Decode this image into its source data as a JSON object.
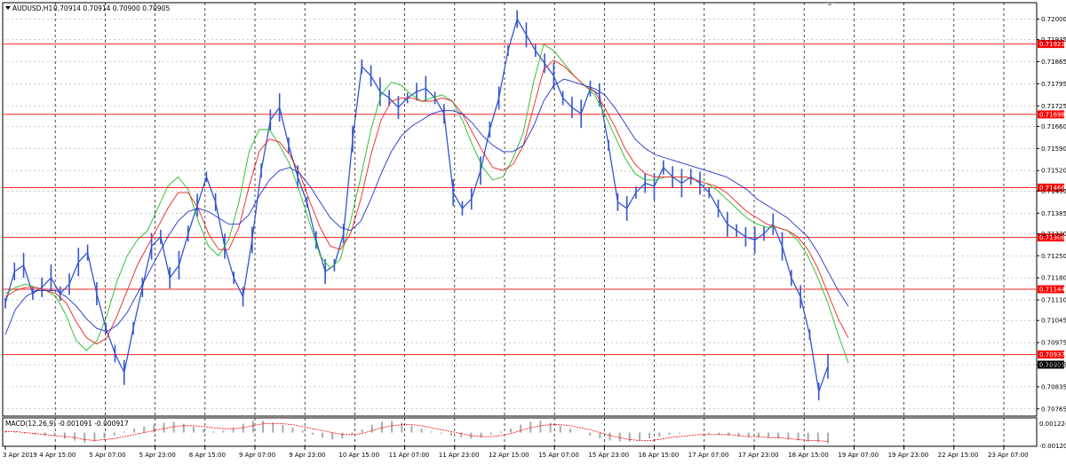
{
  "header": {
    "symbol": "AUDUSD,H1",
    "ohlc": "0.70914 0.70914 0.70900 0.70905"
  },
  "macd": {
    "label": "MACD(12,26,9) -0.001091 -0.000917",
    "axis_top": "0.001224",
    "axis_bottom": "-0.001202"
  },
  "chart_data": {
    "type": "line",
    "title": "AUDUSD,H1",
    "price_scale": {
      "range": [
        0.70742,
        0.72052
      ],
      "ticks": [
        "0.72070",
        "0.72000",
        "0.71935",
        "0.71865",
        "0.71795",
        "0.71725",
        "0.71660",
        "0.71590",
        "0.71520",
        "0.71455",
        "0.71385",
        "0.71320",
        "0.71250",
        "0.71180",
        "0.71110",
        "0.71045",
        "0.70975",
        "0.70905",
        "0.70835",
        "0.70765"
      ]
    },
    "time_labels": [
      "3 Apr 2019",
      "4 Apr 15:00",
      "5 Apr 07:00",
      "5 Apr 23:00",
      "8 Apr 15:00",
      "9 Apr 07:00",
      "9 Apr 23:00",
      "10 Apr 15:00",
      "11 Apr 07:00",
      "11 Apr 23:00",
      "12 Apr 15:00",
      "15 Apr 07:00",
      "15 Apr 23:00",
      "16 Apr 15:00",
      "17 Apr 07:00",
      "17 Apr 23:00",
      "18 Apr 15:00",
      "19 Apr 07:00",
      "19 Apr 23:00",
      "22 Apr 15:00",
      "23 Apr 07:00"
    ],
    "levels": [
      {
        "value": 0.71921,
        "label": "0.71921"
      },
      {
        "value": 0.71698,
        "label": "0.71698"
      },
      {
        "value": 0.71466,
        "label": "0.71466"
      },
      {
        "value": 0.71308,
        "label": "0.71308"
      },
      {
        "value": 0.71144,
        "label": "0.71144"
      },
      {
        "value": 0.70937,
        "label": "0.70937"
      }
    ],
    "current_price": {
      "value": 0.70905,
      "label": "0.70905"
    },
    "series": [
      {
        "key": "price",
        "color": "#3355cc",
        "values": [
          0.711,
          0.712,
          0.7122,
          0.7113,
          0.7115,
          0.7118,
          0.7113,
          0.7116,
          0.7123,
          0.7126,
          0.7113,
          0.7102,
          0.7094,
          0.7088,
          0.7102,
          0.7115,
          0.7128,
          0.7131,
          0.7118,
          0.7122,
          0.7132,
          0.7141,
          0.715,
          0.7142,
          0.7128,
          0.7118,
          0.7112,
          0.713,
          0.7152,
          0.7168,
          0.7172,
          0.716,
          0.715,
          0.7142,
          0.713,
          0.712,
          0.7122,
          0.7132,
          0.7162,
          0.7185,
          0.7182,
          0.7177,
          0.7175,
          0.7172,
          0.7175,
          0.7177,
          0.7178,
          0.7175,
          0.717,
          0.7145,
          0.714,
          0.7143,
          0.7152,
          0.7165,
          0.7175,
          0.719,
          0.72,
          0.7195,
          0.719,
          0.7186,
          0.7182,
          0.7175,
          0.7172,
          0.717,
          0.7178,
          0.7176,
          0.716,
          0.7142,
          0.714,
          0.7145,
          0.7148,
          0.7147,
          0.7153,
          0.715,
          0.7148,
          0.715,
          0.7148,
          0.7145,
          0.714,
          0.7135,
          0.7133,
          0.7131,
          0.713,
          0.7132,
          0.7135,
          0.7128,
          0.7118,
          0.7112,
          0.71,
          0.7082,
          0.709
        ]
      },
      {
        "key": "ma_fast",
        "color": "#22bb22",
        "values": [
          0.7113,
          0.7115,
          0.7116,
          0.7115,
          0.7114,
          0.7112,
          0.7106,
          0.7098,
          0.7095,
          0.7098,
          0.7106,
          0.7117,
          0.7125,
          0.713,
          0.7133,
          0.714,
          0.7147,
          0.715,
          0.7146,
          0.7136,
          0.7128,
          0.7125,
          0.713,
          0.7142,
          0.7158,
          0.7165,
          0.7165,
          0.716,
          0.7154,
          0.7145,
          0.7135,
          0.7125,
          0.7121,
          0.7124,
          0.7136,
          0.715,
          0.7165,
          0.7176,
          0.718,
          0.7179,
          0.7176,
          0.7174,
          0.7175,
          0.7176,
          0.7174,
          0.7168,
          0.716,
          0.7153,
          0.7149,
          0.715,
          0.7156,
          0.7164,
          0.718,
          0.7192,
          0.719,
          0.7186,
          0.7182,
          0.7179,
          0.7176,
          0.717,
          0.7163,
          0.7156,
          0.7151,
          0.7149,
          0.7149,
          0.715,
          0.715,
          0.715,
          0.7149,
          0.7148,
          0.7146,
          0.7143,
          0.714,
          0.7137,
          0.7135,
          0.7134,
          0.7134,
          0.7133,
          0.713,
          0.7125,
          0.7118,
          0.711,
          0.71,
          0.7091
        ]
      },
      {
        "key": "ma_medium",
        "color": "#ee2222",
        "values": [
          0.7112,
          0.7114,
          0.7115,
          0.7115,
          0.7114,
          0.7113,
          0.711,
          0.7104,
          0.7099,
          0.7097,
          0.7099,
          0.7106,
          0.7114,
          0.7122,
          0.7128,
          0.7134,
          0.714,
          0.7145,
          0.7145,
          0.714,
          0.7132,
          0.7127,
          0.7127,
          0.7134,
          0.7147,
          0.7158,
          0.7162,
          0.7161,
          0.7157,
          0.7151,
          0.7142,
          0.7134,
          0.7128,
          0.7127,
          0.7132,
          0.7143,
          0.7157,
          0.7168,
          0.7174,
          0.7175,
          0.7175,
          0.7174,
          0.7174,
          0.7175,
          0.7174,
          0.717,
          0.7164,
          0.7158,
          0.7153,
          0.7152,
          0.7154,
          0.716,
          0.7172,
          0.7184,
          0.7187,
          0.7185,
          0.7182,
          0.7179,
          0.7177,
          0.7172,
          0.7166,
          0.7159,
          0.7154,
          0.7151,
          0.715,
          0.715,
          0.715,
          0.715,
          0.7149,
          0.7148,
          0.7147,
          0.7145,
          0.7142,
          0.7139,
          0.7137,
          0.7135,
          0.7134,
          0.7133,
          0.7131,
          0.7127,
          0.7121,
          0.7113,
          0.7105,
          0.7099
        ]
      },
      {
        "key": "ma_slow",
        "color": "#2233cc",
        "values": [
          0.71,
          0.7108,
          0.7112,
          0.7114,
          0.7114,
          0.7114,
          0.7112,
          0.7109,
          0.7105,
          0.7102,
          0.7101,
          0.7103,
          0.7107,
          0.7113,
          0.7119,
          0.7125,
          0.7131,
          0.7136,
          0.7139,
          0.714,
          0.7139,
          0.7137,
          0.7135,
          0.7135,
          0.7138,
          0.7144,
          0.7149,
          0.7152,
          0.7153,
          0.7151,
          0.7147,
          0.7142,
          0.7137,
          0.7134,
          0.7133,
          0.7136,
          0.7143,
          0.7151,
          0.7158,
          0.7163,
          0.7166,
          0.7168,
          0.717,
          0.7171,
          0.7171,
          0.717,
          0.7167,
          0.7163,
          0.716,
          0.7158,
          0.7158,
          0.716,
          0.7166,
          0.7174,
          0.7179,
          0.7181,
          0.718,
          0.7179,
          0.7178,
          0.7176,
          0.7172,
          0.7167,
          0.7162,
          0.7159,
          0.7157,
          0.7156,
          0.7155,
          0.7154,
          0.7153,
          0.7152,
          0.7151,
          0.715,
          0.7148,
          0.7146,
          0.7143,
          0.7141,
          0.7139,
          0.7137,
          0.7134,
          0.7131,
          0.7126,
          0.712,
          0.7114,
          0.7109
        ]
      }
    ],
    "macd_values": [
      0.0002,
      0.0001,
      -0.0001,
      -0.0002,
      -0.0003,
      -0.0004,
      -0.0006,
      -0.0008,
      -0.001,
      -0.0009,
      -0.0006,
      -0.0003,
      0.0001,
      0.0004,
      0.0006,
      0.0008,
      0.001,
      0.0011,
      0.0009,
      0.0006,
      0.0003,
      0.0001,
      0.0002,
      0.0005,
      0.0009,
      0.0012,
      0.0012,
      0.001,
      0.0008,
      0.0005,
      0.0002,
      -0.0002,
      -0.0005,
      -0.0007,
      -0.0006,
      -0.0002,
      0.0003,
      0.0008,
      0.0011,
      0.0012,
      0.001,
      0.0007,
      0.0004,
      0.0001,
      -0.0001,
      -0.0003,
      -0.0005,
      -0.0006,
      -0.0005,
      -0.0002,
      0.0001,
      0.0004,
      0.0008,
      0.0011,
      0.0012,
      0.001,
      0.0007,
      0.0004,
      0.0,
      -0.0003,
      -0.0006,
      -0.0008,
      -0.0009,
      -0.0009,
      -0.0008,
      -0.0006,
      -0.0004,
      -0.0002,
      -0.0001,
      0.0,
      0.0,
      -0.0001,
      -0.0002,
      -0.0003,
      -0.0004,
      -0.0005,
      -0.0005,
      -0.0005,
      -0.0006,
      -0.0007,
      -0.0008,
      -0.0009,
      -0.001,
      -0.0011
    ],
    "macd_signal": [
      0.0001,
      0.0001,
      0.0,
      -0.0001,
      -0.0002,
      -0.0003,
      -0.0004,
      -0.0005,
      -0.0007,
      -0.0008,
      -0.0007,
      -0.0006,
      -0.0004,
      -0.0002,
      0.0,
      0.0002,
      0.0004,
      0.0006,
      0.0007,
      0.0007,
      0.0006,
      0.0005,
      0.0004,
      0.0004,
      0.0005,
      0.0007,
      0.0009,
      0.0009,
      0.0009,
      0.0008,
      0.0006,
      0.0004,
      0.0002,
      0.0,
      -0.0002,
      -0.0002,
      -0.0001,
      0.0002,
      0.0005,
      0.0007,
      0.0008,
      0.0008,
      0.0007,
      0.0005,
      0.0003,
      0.0001,
      -0.0001,
      -0.0003,
      -0.0004,
      -0.0004,
      -0.0003,
      -0.0001,
      0.0002,
      0.0005,
      0.0007,
      0.0008,
      0.0008,
      0.0007,
      0.0005,
      0.0003,
      0.0,
      -0.0003,
      -0.0005,
      -0.0007,
      -0.0008,
      -0.0008,
      -0.0007,
      -0.0005,
      -0.0004,
      -0.0003,
      -0.0002,
      -0.0002,
      -0.0002,
      -0.0002,
      -0.0003,
      -0.0004,
      -0.0004,
      -0.0005,
      -0.0005,
      -0.0006,
      -0.0007,
      -0.0008,
      -0.0008,
      -0.0009
    ]
  }
}
